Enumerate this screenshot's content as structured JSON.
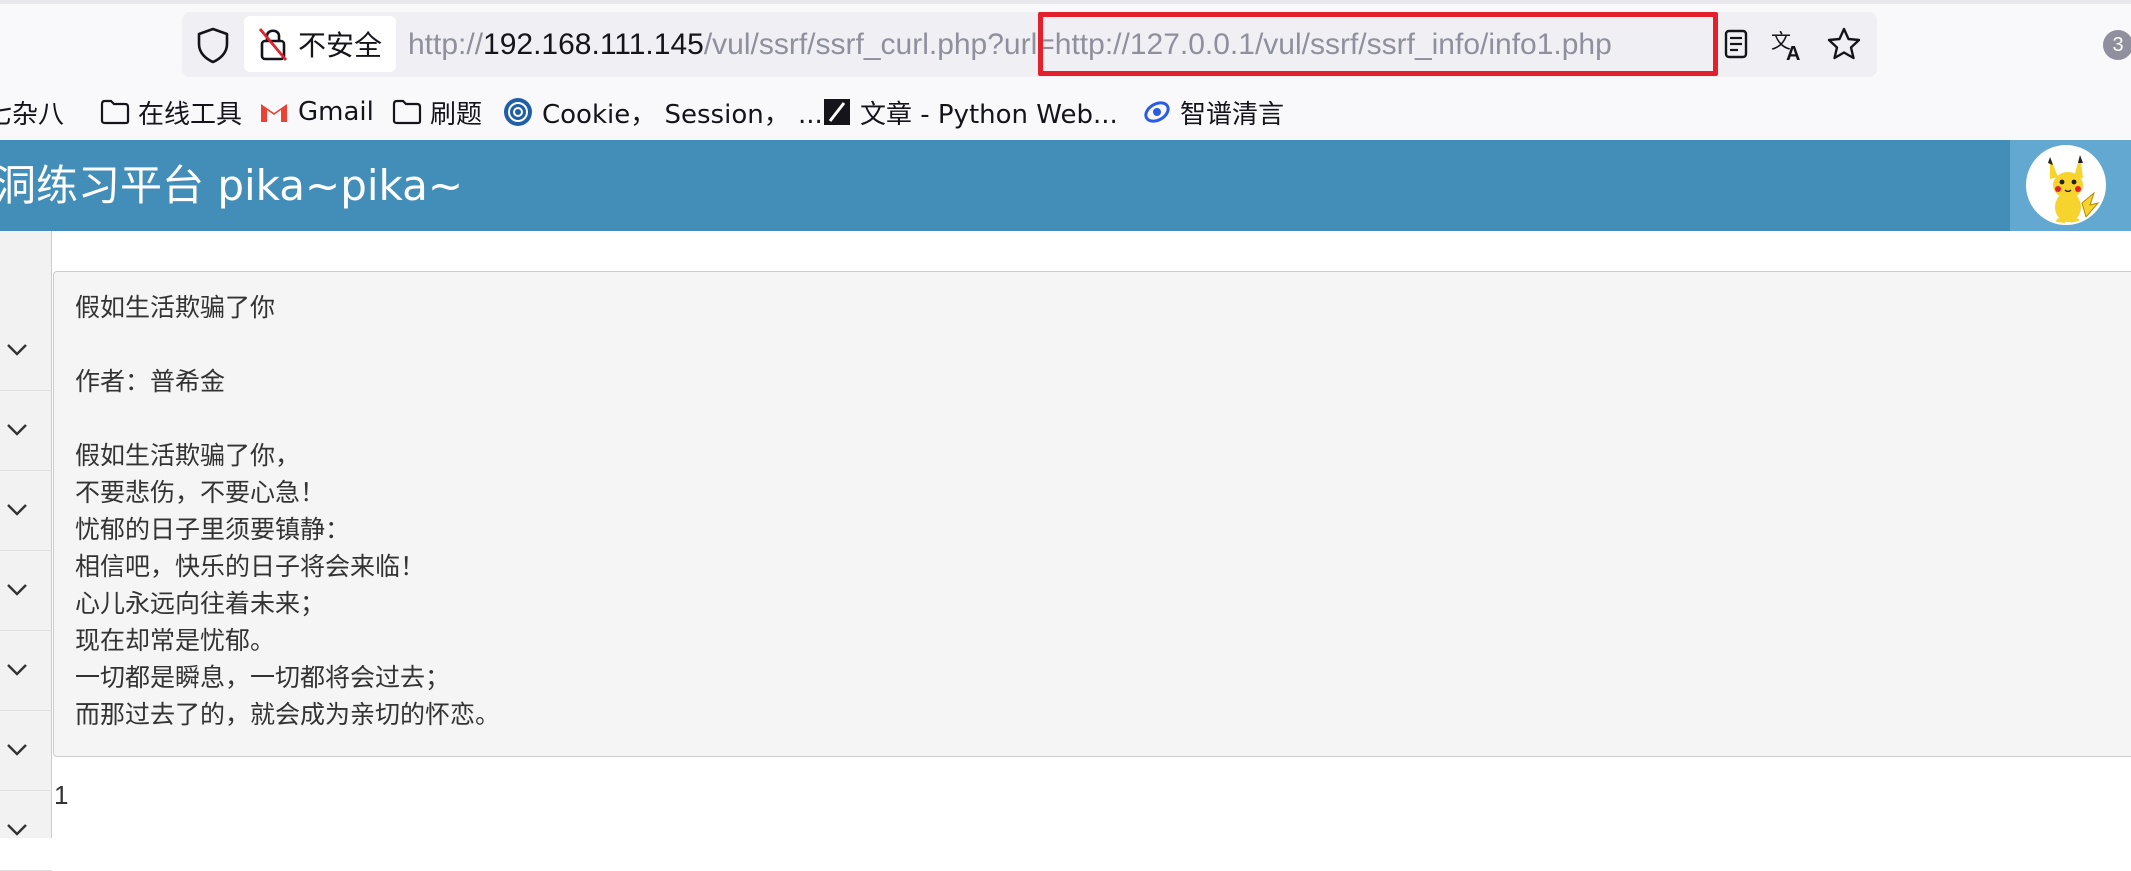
{
  "browser": {
    "security_label": "不安全",
    "url_prefix": "http://",
    "url_host": "192.168.111.145",
    "url_path": "/vul/ssrf/ssrf_curl.php?url=http://127.0.0.1/vul/ssrf/ssrf_info/info1.php",
    "tab_count": "3"
  },
  "bookmarks": [
    {
      "label": "七杂八",
      "icon": "folder-icon"
    },
    {
      "label": "在线工具",
      "icon": "folder-icon"
    },
    {
      "label": "Gmail",
      "icon": "gmail-icon"
    },
    {
      "label": "刷题",
      "icon": "folder-icon"
    },
    {
      "label": "Cookie， Session， ...",
      "icon": "site-icon"
    },
    {
      "label": "文章 - Python Web...",
      "icon": "site-icon"
    },
    {
      "label": "智谱清言",
      "icon": "site-icon"
    }
  ],
  "header": {
    "title": "洞练习平台 pika~pika~"
  },
  "poem": {
    "lines": [
      "假如生活欺骗了你",
      "",
      "作者：普希金",
      "",
      "假如生活欺骗了你，",
      "不要悲伤，不要心急！",
      "忧郁的日子里须要镇静：",
      "相信吧，快乐的日子将会来临！",
      "心儿永远向往着未来；",
      "现在却常是忧郁。",
      "一切都是瞬息，一切都将会过去；",
      "而那过去了的，就会成为亲切的怀恋。"
    ]
  },
  "result": {
    "value": "1"
  },
  "colors": {
    "header_bg": "#438eb9",
    "highlight_border": "#e3202c"
  }
}
